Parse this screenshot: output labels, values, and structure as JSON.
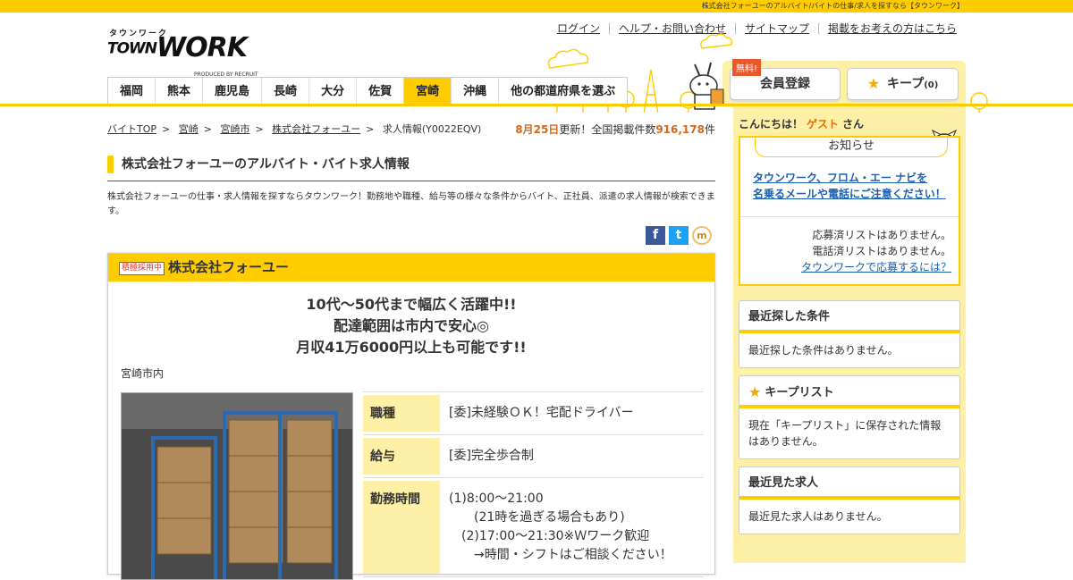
{
  "topbar": {
    "text": "株式会社フォーユーのアルバイト/バイトの仕事/求人を探すなら【タウンワーク】"
  },
  "logo": {
    "kana": "タウンワーク",
    "town": "TOWN",
    "work": "WORK",
    "produced": "PRODUCED BY RECRUIT"
  },
  "toplinks": [
    "ログイン",
    "ヘルプ・お問い合わせ",
    "サイトマップ",
    "掲載をお考えの方はこちら"
  ],
  "prefectures": [
    "福岡",
    "熊本",
    "鹿児島",
    "長崎",
    "大分",
    "佐賀",
    "宮崎",
    "沖縄",
    "他の都道府県を選ぶ"
  ],
  "active_prefecture": "宮崎",
  "member": {
    "free_badge": "無料!",
    "register_label": "会員登録",
    "keep_label": "キープ",
    "keep_count": "(0)"
  },
  "breadcrumb": {
    "items": [
      "バイトTOP",
      "宮崎",
      "宮崎市",
      "株式会社フォーユー"
    ],
    "current": "求人情報(Y0022EQV)"
  },
  "update": {
    "date": "8月25日",
    "text1": "更新！全国掲載件数",
    "count": "916,178",
    "unit": "件"
  },
  "page_title": "株式会社フォーユーのアルバイト・バイト求人情報",
  "description": "株式会社フォーユーの仕事・求人情報を探すならタウンワーク！勤務地や職種、給与等の様々な条件からバイト、正社員、派遣の求人情報が検索できます。",
  "job": {
    "badge": "積極採用中",
    "company": "株式会社フォーユー",
    "catch": [
      "10代～50代まで幅広く活躍中!!",
      "配達範囲は市内で安心◎",
      "月収41万6000円以上も可能です!!"
    ],
    "location": "宮崎市内",
    "table": [
      {
        "label": "職種",
        "value": [
          "[委]未経験ＯＫ！宅配ドライバー"
        ]
      },
      {
        "label": "給与",
        "value": [
          "[委]完全歩合制"
        ]
      },
      {
        "label": "勤務時間",
        "value": [
          "(1)8:00～21:00",
          "(21時を過ぎる場合もあり)",
          "(2)17:00～21:30※Ｗワーク歓迎",
          "→時間・シフトはご相談ください！"
        ]
      }
    ]
  },
  "sidebar": {
    "hello_prefix": "こんにちは！",
    "guest": "ゲスト",
    "hello_suffix": "さん",
    "notice_title": "お知らせ",
    "notice_link": [
      "タウンワーク、フロム・エー ナビを",
      "名乗るメールや電話にご注意ください！"
    ],
    "status": [
      "応募済リストはありません。",
      "電話済リストはありません。"
    ],
    "status_link": "タウンワークで応募するには？",
    "boxes": [
      {
        "title": "最近探した条件",
        "body": "最近探した条件はありません。"
      },
      {
        "title": "キープリスト",
        "body": "現在「キープリスト」に保存された情報はありません。"
      },
      {
        "title": "最近見た求人",
        "body": "最近見た求人はありません。"
      }
    ]
  },
  "colors": {
    "brand_yellow": "#ffcc00",
    "light_yellow": "#fff0a8",
    "accent_orange": "#e07000",
    "link_blue": "#1a5fb4"
  }
}
